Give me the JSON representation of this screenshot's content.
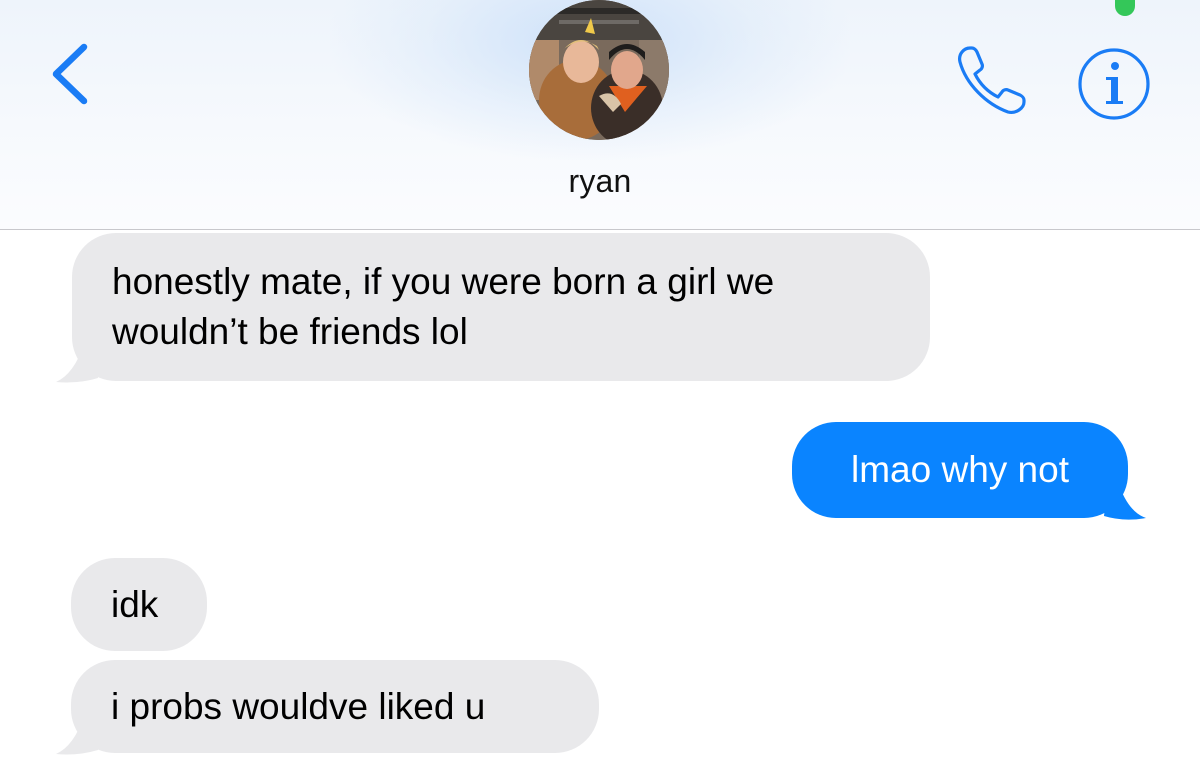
{
  "header": {
    "contact_name": "ryan",
    "back_icon": "chevron-left-icon",
    "call_icon": "phone-icon",
    "info_icon": "info-icon",
    "accent_color": "#1a7cf5",
    "status_dot_color": "#34c759"
  },
  "messages": [
    {
      "direction": "received",
      "text": "honestly mate, if you were born a girl we wouldn’t be friends lol"
    },
    {
      "direction": "sent",
      "text": "lmao why not"
    },
    {
      "direction": "received",
      "text": "idk"
    },
    {
      "direction": "received",
      "text": "i probs wouldve liked u"
    }
  ],
  "colors": {
    "received_bubble": "#e9e9eb",
    "sent_bubble": "#0a84ff",
    "received_text": "#000000",
    "sent_text": "#ffffff"
  }
}
